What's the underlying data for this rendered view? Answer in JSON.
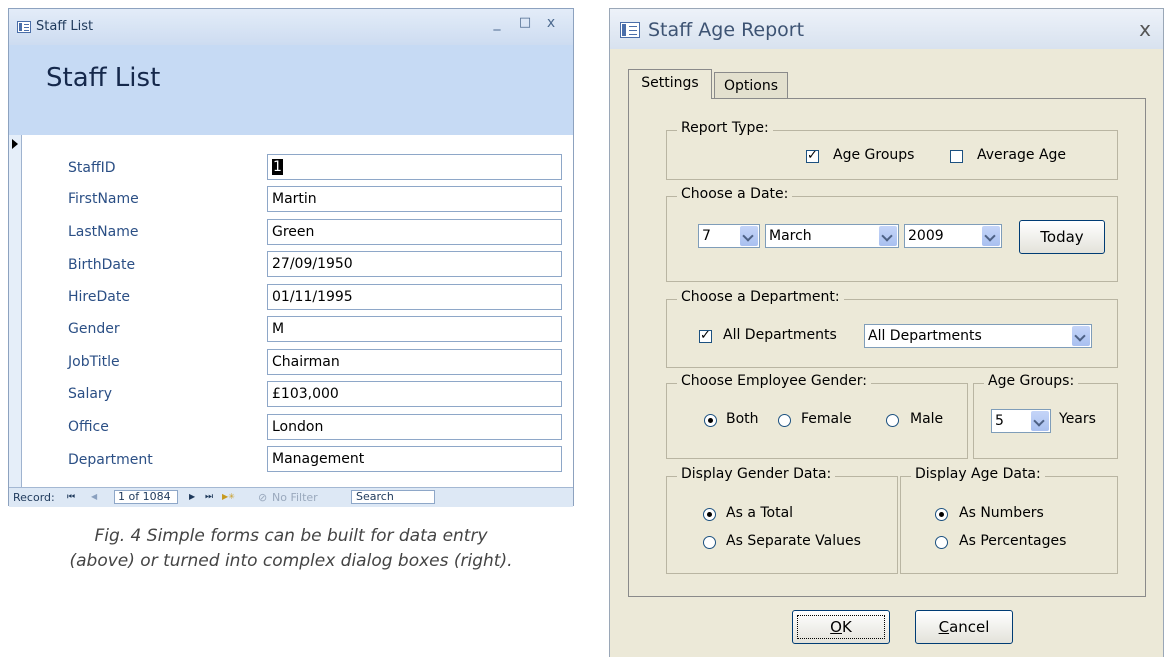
{
  "staff_list": {
    "window_title": "Staff List",
    "heading": "Staff List",
    "controls": {
      "minimize": "_",
      "maximize": "□",
      "close": "x"
    },
    "fields": [
      {
        "label": "StaffID",
        "value": "1"
      },
      {
        "label": "FirstName",
        "value": "Martin"
      },
      {
        "label": "LastName",
        "value": "Green"
      },
      {
        "label": "BirthDate",
        "value": "27/09/1950"
      },
      {
        "label": "HireDate",
        "value": "01/11/1995"
      },
      {
        "label": "Gender",
        "value": "M"
      },
      {
        "label": "JobTitle",
        "value": "Chairman"
      },
      {
        "label": "Salary",
        "value": "£103,000"
      },
      {
        "label": "Office",
        "value": "London"
      },
      {
        "label": "Department",
        "value": "Management"
      }
    ],
    "navigation": {
      "record_label": "Record:",
      "first": "⏮",
      "prev": "◀",
      "position": "1 of 1084",
      "next": "▶",
      "last": "⏭",
      "new": "▶✳",
      "filter": "No Filter",
      "search": "Search"
    }
  },
  "caption": {
    "line1": "Fig. 4 Simple forms can be built for data entry",
    "line2": "(above) or turned into complex dialog boxes (right)."
  },
  "dialog": {
    "title": "Staff Age Report",
    "close": "x",
    "tabs": [
      "Settings",
      "Options"
    ],
    "report_type": {
      "legend": "Report Type:",
      "age_groups": {
        "label": "Age Groups",
        "checked": true
      },
      "average_age": {
        "label": "Average Age",
        "checked": false
      }
    },
    "date": {
      "legend": "Choose a Date:",
      "day": "7",
      "month": "March",
      "year": "2009",
      "today_button": "Today"
    },
    "department": {
      "legend": "Choose a Department:",
      "all_label": "All Departments",
      "all_checked": true,
      "selected": "All Departments"
    },
    "gender": {
      "legend": "Choose Employee Gender:",
      "options": [
        "Both",
        "Female",
        "Male"
      ],
      "selected": "Both"
    },
    "age_groups": {
      "legend": "Age Groups:",
      "value": "5",
      "unit": "Years"
    },
    "gender_display": {
      "legend": "Display Gender Data:",
      "options": [
        "As a Total",
        "As Separate Values"
      ],
      "selected": "As a Total"
    },
    "age_display": {
      "legend": "Display Age Data:",
      "options": [
        "As Numbers",
        "As Percentages"
      ],
      "selected": "As Numbers"
    },
    "ok_button": {
      "accel": "O",
      "rest": "K"
    },
    "cancel_button": {
      "accel": "C",
      "rest": "ancel"
    }
  }
}
